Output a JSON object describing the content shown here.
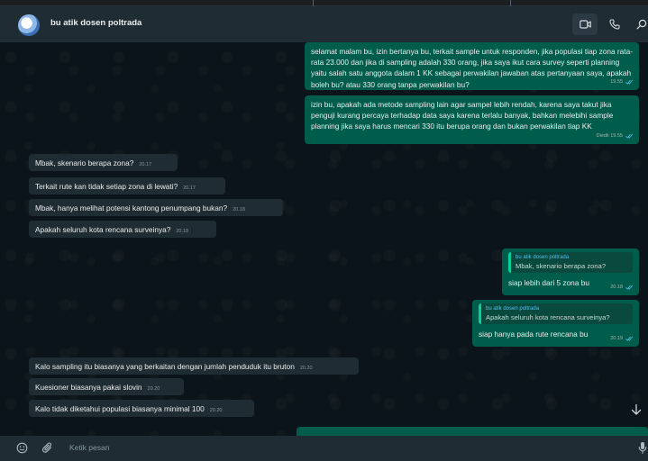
{
  "header": {
    "contact_name": "bu atik dosen poltrada"
  },
  "messages": [
    {
      "dir": "out",
      "text": "selamat malam bu, izin bertanya bu, terkait sample untuk responden, jika populasi tiap zona rata-rata 23.000 dan jika di sampling adalah 330 orang, jika saya ikut cara survey seperti planning yaitu salah satu anggota dalam 1 KK sebagai perwakilan jawaban atas pertanyaan saya, apakah boleh bu? atau 330 orang tanpa perwakilan bu?",
      "time": "19.55"
    },
    {
      "dir": "out",
      "text": "izin bu, apakah ada metode sampling lain agar sampel lebih rendah, karena saya takut jika penguji kurang percaya terhadap data saya karena terlalu banyak, bahkan melebihi sample planning jika saya harus mencari 330 itu berupa orang dan bukan perwakilan tiap KK",
      "time": "Diedit 19.55"
    },
    {
      "dir": "in",
      "text": "Mbak, skenario berapa zona?",
      "time": "20.17"
    },
    {
      "dir": "in",
      "text": "Terkait rute kan tidak setiap zona di lewati?",
      "time": "20.17"
    },
    {
      "dir": "in",
      "text": "Mbak, hanya melihat potensi kantong penumpang bukan?",
      "time": "20.18"
    },
    {
      "dir": "in",
      "text": "Apakah seluruh kota rencana surveinya?",
      "time": "20.18"
    },
    {
      "dir": "out",
      "quote_name": "bu atik dosen poltrada",
      "quote_text": "Mbak, skenario berapa zona?",
      "text": "siap lebih dari 5 zona bu",
      "time": "20.18"
    },
    {
      "dir": "out",
      "quote_name": "bu atik dosen poltrada",
      "quote_text": "Apakah seluruh kota rencana surveinya?",
      "text": "siap hanya pada rute rencana bu",
      "time": "20.19"
    },
    {
      "dir": "in",
      "text": "Kalo sampling itu biasanya yang berkaitan dengan jumlah penduduk itu bruton",
      "time": "20.20"
    },
    {
      "dir": "in",
      "text": "Kuesioner biasanya pakai slovin",
      "time": "20.20"
    },
    {
      "dir": "in",
      "text": "Kalo tidak diketahui populasi biasanya minimal 100",
      "time": "20.20"
    }
  ],
  "composer": {
    "placeholder": "Ketik pesan"
  },
  "icons": {
    "header": [
      "avatar",
      "video-call-icon",
      "voice-call-icon",
      "search-icon"
    ],
    "footer": [
      "emoji-icon",
      "attach-icon",
      "mic-icon"
    ],
    "chat": [
      "scroll-down-icon",
      "double-check-icon"
    ]
  },
  "colors": {
    "outgoing_bubble": "#005c4b",
    "incoming_bubble": "#202c33",
    "header_bg": "#1f2c33",
    "chat_bg": "#0b141a",
    "read_tick": "#53bdeb"
  }
}
